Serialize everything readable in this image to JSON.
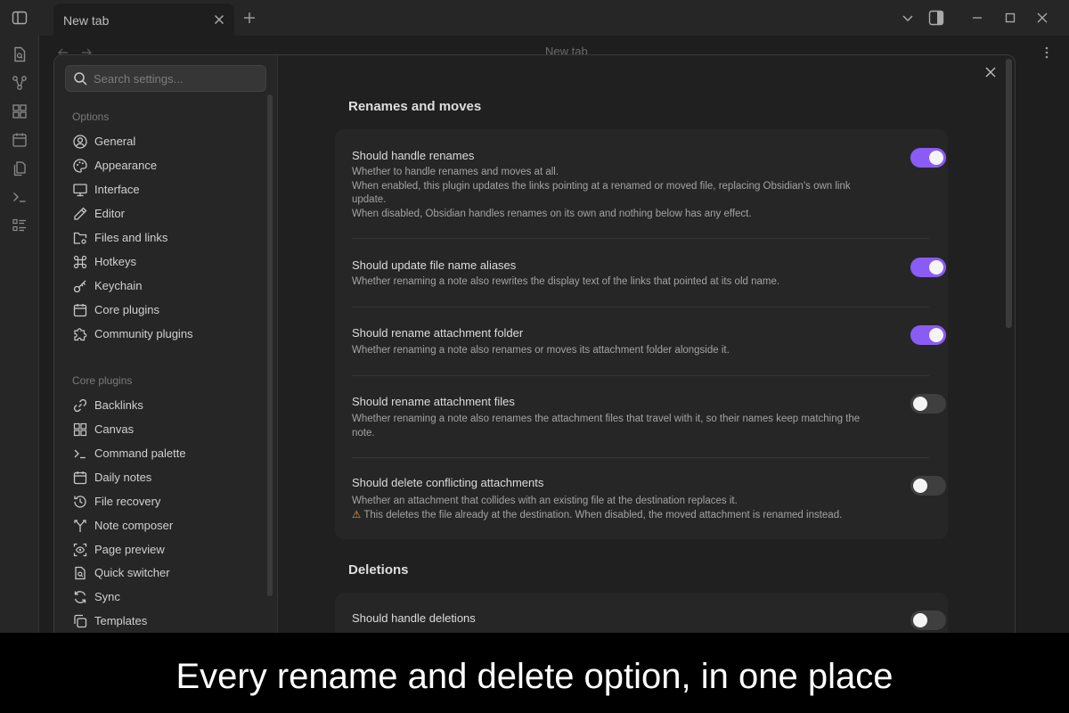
{
  "window": {
    "tab_title": "New tab",
    "workspace_title": "New tab"
  },
  "settings_modal": {
    "search": {
      "placeholder": "Search settings...",
      "value": ""
    },
    "options_heading": "Options",
    "options_items": [
      {
        "label": "General",
        "icon": "user-circle-icon"
      },
      {
        "label": "Appearance",
        "icon": "palette-icon"
      },
      {
        "label": "Interface",
        "icon": "monitor-icon"
      },
      {
        "label": "Editor",
        "icon": "pencil-icon"
      },
      {
        "label": "Files and links",
        "icon": "folder-cog-icon"
      },
      {
        "label": "Hotkeys",
        "icon": "command-icon"
      },
      {
        "label": "Keychain",
        "icon": "key-icon"
      },
      {
        "label": "Core plugins",
        "icon": "calendar-plug-icon"
      },
      {
        "label": "Community plugins",
        "icon": "puzzle-icon"
      }
    ],
    "core_plugins_heading": "Core plugins",
    "core_plugin_items": [
      {
        "label": "Backlinks",
        "icon": "link-icon"
      },
      {
        "label": "Canvas",
        "icon": "layout-dashboard-icon"
      },
      {
        "label": "Command palette",
        "icon": "terminal-icon"
      },
      {
        "label": "Daily notes",
        "icon": "calendar-icon"
      },
      {
        "label": "File recovery",
        "icon": "history-icon"
      },
      {
        "label": "Note composer",
        "icon": "merge-icon"
      },
      {
        "label": "Page preview",
        "icon": "scan-eye-icon"
      },
      {
        "label": "Quick switcher",
        "icon": "file-search-icon"
      },
      {
        "label": "Sync",
        "icon": "refresh-icon"
      },
      {
        "label": "Templates",
        "icon": "copy-icon"
      }
    ],
    "sections": [
      {
        "heading": "Renames and moves",
        "settings": [
          {
            "name": "Should handle renames",
            "desc": [
              "Whether to handle renames and moves at all.",
              "When enabled, this plugin updates the links pointing at a renamed or moved file, replacing Obsidian's own link update.",
              "When disabled, Obsidian handles renames on its own and nothing below has any effect."
            ],
            "enabled": true
          },
          {
            "name": "Should update file name aliases",
            "desc": [
              "Whether renaming a note also rewrites the display text of the links that pointed at its old name."
            ],
            "enabled": true
          },
          {
            "name": "Should rename attachment folder",
            "desc": [
              "Whether renaming a note also renames or moves its attachment folder alongside it."
            ],
            "enabled": true
          },
          {
            "name": "Should rename attachment files",
            "desc": [
              "Whether renaming a note also renames the attachment files that travel with it, so their names keep matching the note."
            ],
            "enabled": false
          },
          {
            "name": "Should delete conflicting attachments",
            "desc": [
              "Whether an attachment that collides with an existing file at the destination replaces it."
            ],
            "warning": "This deletes the file already at the destination. When disabled, the moved attachment is renamed instead.",
            "enabled": false
          }
        ]
      },
      {
        "heading": "Deletions",
        "settings": [
          {
            "name": "Should handle deletions",
            "enabled": false
          }
        ]
      }
    ]
  },
  "caption": "Every rename and delete option, in one place",
  "colors": {
    "accent": "#8a5cf5",
    "toggle_off": "#3f3f3f",
    "warning": "#e8a93a"
  }
}
